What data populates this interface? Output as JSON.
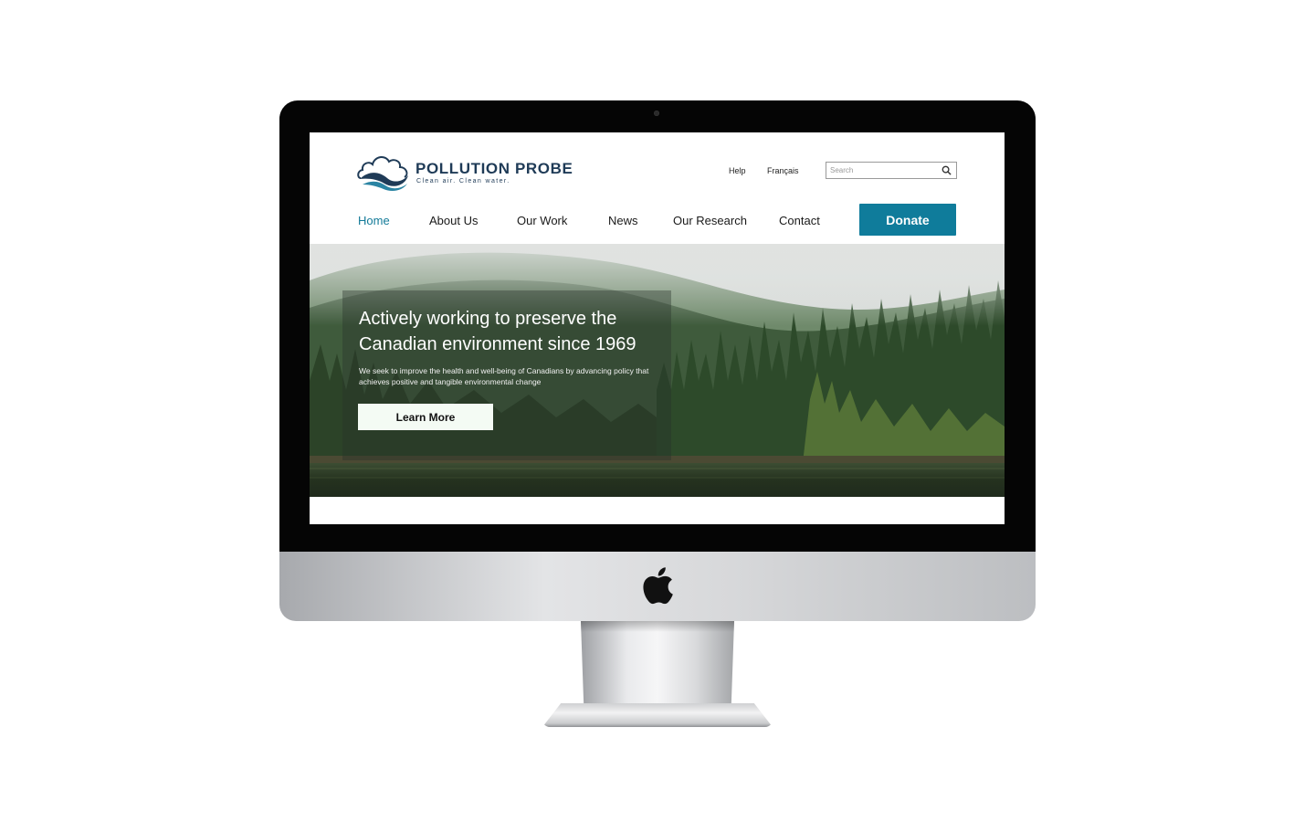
{
  "brand": {
    "name": "POLLUTION PROBE",
    "tagline": "Clean air. Clean water."
  },
  "utility_nav": {
    "help": "Help",
    "language": "Français",
    "search_placeholder": "Search"
  },
  "main_nav": {
    "items": [
      {
        "label": "Home",
        "active": true
      },
      {
        "label": "About Us",
        "active": false
      },
      {
        "label": "Our Work",
        "active": false
      },
      {
        "label": "News",
        "active": false
      },
      {
        "label": "Our Research",
        "active": false
      },
      {
        "label": "Contact",
        "active": false
      }
    ],
    "donate_label": "Donate"
  },
  "hero": {
    "title": "Actively working to preserve the Canadian environment since 1969",
    "subtitle": "We seek to improve the health and well-being of Canadians by advancing policy that achieves positive and tangible environmental change",
    "cta_label": "Learn More"
  },
  "colors": {
    "accent": "#0f7c9b",
    "brand_navy": "#1f3b57"
  },
  "icons": {
    "device": "apple-logo",
    "search": "search-icon",
    "logo": "cloud-wave-logo"
  }
}
